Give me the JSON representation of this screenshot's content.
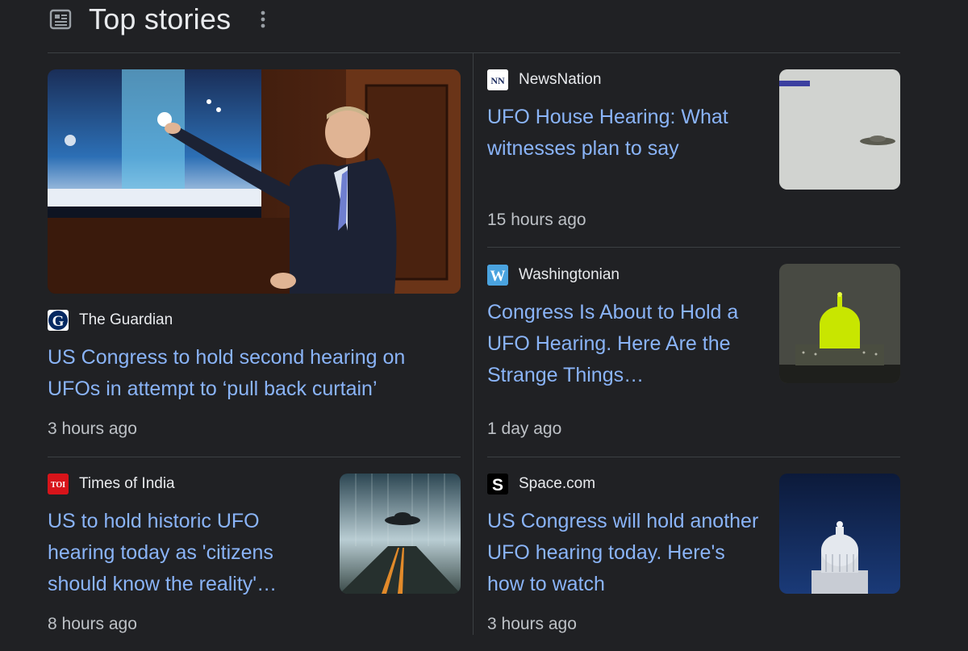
{
  "header": {
    "title": "Top stories",
    "icon": "news-icon",
    "more_icon": "more-vert-icon"
  },
  "colors": {
    "background": "#202124",
    "link": "#8ab4f8",
    "text": "#e8eaed",
    "muted": "#bdc1c6",
    "divider": "#3c4043"
  },
  "stories": [
    {
      "source": "The Guardian",
      "logo_text": "G",
      "headline": "US Congress to hold second hearing on UFOs in attempt to ‘pull back curtain’",
      "time": "3 hours ago"
    },
    {
      "source": "NewsNation",
      "logo_text": "NN",
      "headline": "UFO House Hearing: What witnesses plan to say",
      "time": "15 hours ago"
    },
    {
      "source": "Washingtonian",
      "logo_text": "W",
      "headline": "Congress Is About to Hold a UFO Hearing. Here Are the Strange Things…",
      "time": "1 day ago"
    },
    {
      "source": "Times of India",
      "logo_text": "TOI",
      "headline": "US to hold historic UFO hearing today as 'citizens should know the reality'…",
      "time": "8 hours ago"
    },
    {
      "source": "Space.com",
      "logo_text": "S",
      "headline": "US Congress will hold another UFO hearing today. Here's how to watch",
      "time": "3 hours ago"
    }
  ]
}
